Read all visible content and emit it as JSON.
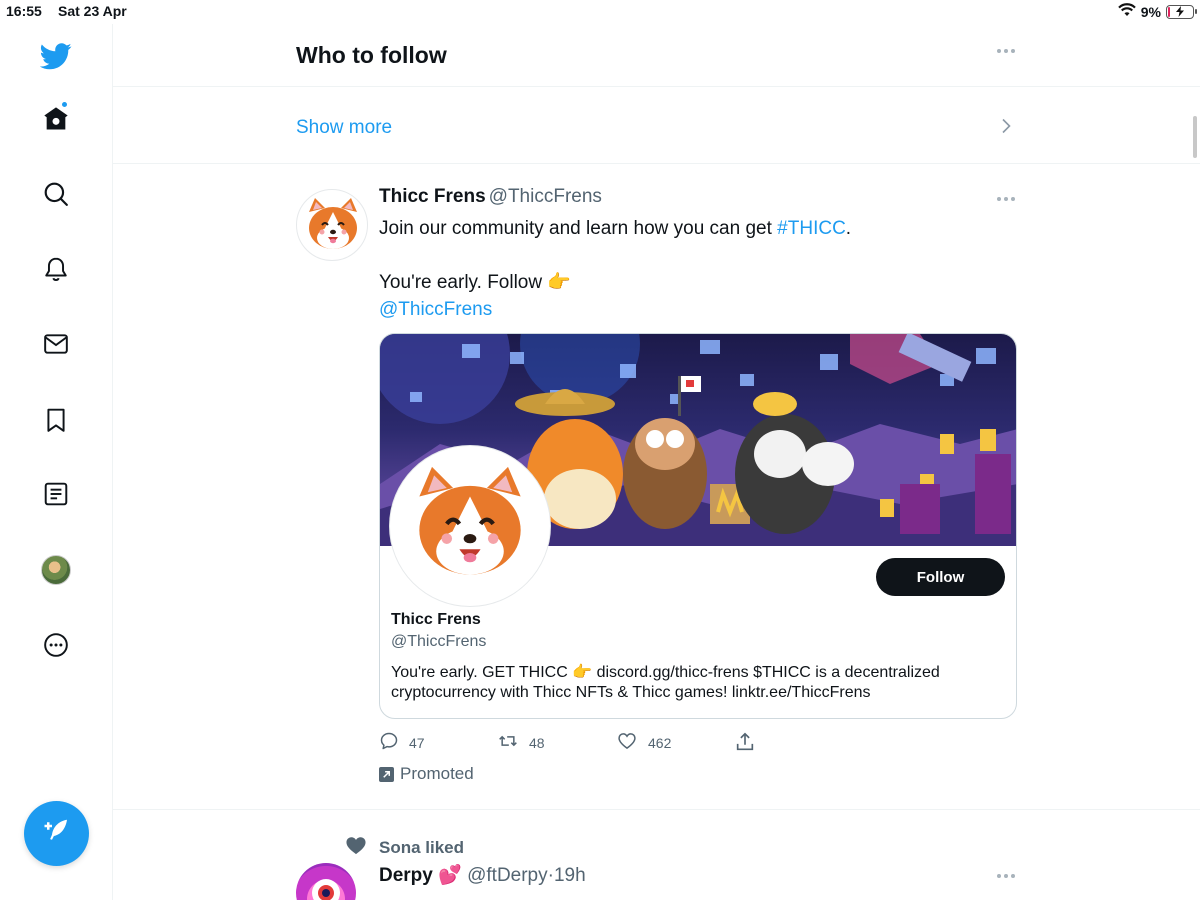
{
  "status_bar": {
    "time": "16:55",
    "date": "Sat 23 Apr",
    "battery_text": "9%",
    "battery_level": 0.09
  },
  "sidebar": {
    "items": [
      {
        "name": "twitter-logo",
        "icon": "twitter-bird-icon"
      },
      {
        "name": "home",
        "icon": "home-icon"
      },
      {
        "name": "explore",
        "icon": "search-icon"
      },
      {
        "name": "notifications",
        "icon": "bell-icon"
      },
      {
        "name": "messages",
        "icon": "mail-icon"
      },
      {
        "name": "bookmarks",
        "icon": "bookmark-icon"
      },
      {
        "name": "lists",
        "icon": "list-icon"
      },
      {
        "name": "profile",
        "icon": "avatar"
      },
      {
        "name": "more",
        "icon": "more-circle-icon"
      }
    ],
    "compose_icon": "feather-plus-icon"
  },
  "who_to_follow": {
    "title": "Who to follow",
    "show_more": "Show more"
  },
  "tweet": {
    "name": "Thicc Frens",
    "handle": "@ThiccFrens",
    "text_before_hashtag": "Join our community and learn how you can get ",
    "hashtag": "#THICC",
    "text_after_hashtag": ".",
    "line2": "You're early. Follow 👉",
    "mention": "@ThiccFrens",
    "card": {
      "name": "Thicc Frens",
      "handle": "@ThiccFrens",
      "bio": "You're early. GET THICC 👉 discord.gg/thicc-frens $THICC is a decentralized cryptocurrency with Thicc NFTs & Thicc games! linktr.ee/ThiccFrens",
      "follow_label": "Follow"
    },
    "actions": {
      "replies": "47",
      "retweets": "48",
      "likes": "462"
    },
    "promoted_label": "Promoted"
  },
  "next_tweet": {
    "liked_by": "Sona liked",
    "name": "Derpy",
    "name_emoji": "💕",
    "handle": "@ftDerpy",
    "separator": "·",
    "time": "19h"
  },
  "colors": {
    "accent": "#1d9bf0",
    "text": "#0f1419",
    "secondary": "#536471",
    "border": "#eff3f4"
  }
}
